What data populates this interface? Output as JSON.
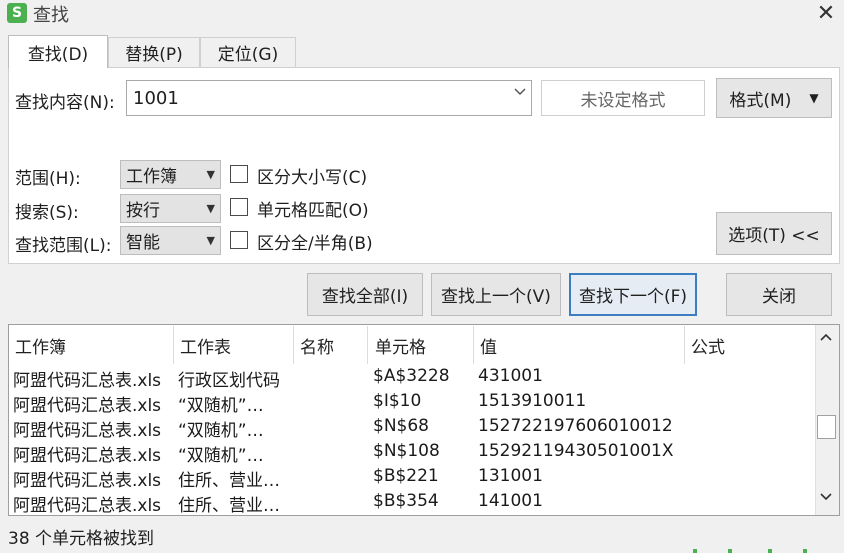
{
  "window": {
    "app_icon": "S",
    "title": "查找",
    "close_glyph": "✕"
  },
  "tabs": [
    {
      "label": "查找(D)"
    },
    {
      "label": "替换(P)"
    },
    {
      "label": "定位(G)"
    }
  ],
  "find": {
    "label": "查找内容(N):",
    "value": "1001",
    "dropdown_icon": "chevron-down-icon",
    "format_status": "未设定格式",
    "format_button": "格式(M)"
  },
  "options": {
    "scope_label": "范围(H):",
    "scope_value": "工作簿",
    "search_label": "搜索(S):",
    "search_value": "按行",
    "lookin_label": "查找范围(L):",
    "lookin_value": "智能",
    "match_case_label": "区分大小写(C)",
    "match_cell_label": "单元格匹配(O)",
    "match_width_label": "区分全/半角(B)",
    "options_button": "选项(T) <<"
  },
  "actions": {
    "find_all": "查找全部(I)",
    "find_prev": "查找上一个(V)",
    "find_next": "查找下一个(F)",
    "close": "关闭"
  },
  "results": {
    "columns": [
      "工作簿",
      "工作表",
      "名称",
      "单元格",
      "值",
      "公式"
    ],
    "rows": [
      {
        "workbook": "阿盟代码汇总表.xls",
        "sheet": "行政区划代码",
        "name": "",
        "cell": "$A$3228",
        "value": "431001",
        "formula": ""
      },
      {
        "workbook": "阿盟代码汇总表.xls",
        "sheet": "“双随机”…",
        "name": "",
        "cell": "$I$10",
        "value": "1513910011",
        "formula": ""
      },
      {
        "workbook": "阿盟代码汇总表.xls",
        "sheet": "“双随机”…",
        "name": "",
        "cell": "$N$68",
        "value": "152722197606010012",
        "formula": ""
      },
      {
        "workbook": "阿盟代码汇总表.xls",
        "sheet": "“双随机”…",
        "name": "",
        "cell": "$N$108",
        "value": "15292119430501001X",
        "formula": ""
      },
      {
        "workbook": "阿盟代码汇总表.xls",
        "sheet": "住所、营业…",
        "name": "",
        "cell": "$B$221",
        "value": "131001",
        "formula": ""
      },
      {
        "workbook": "阿盟代码汇总表.xls",
        "sheet": "住所、营业…",
        "name": "",
        "cell": "$B$354",
        "value": "141001",
        "formula": ""
      }
    ]
  },
  "status": {
    "text": "38 个单元格被找到"
  },
  "colors": {
    "accent": "#3c7fc1",
    "app_icon": "#4caf50"
  }
}
